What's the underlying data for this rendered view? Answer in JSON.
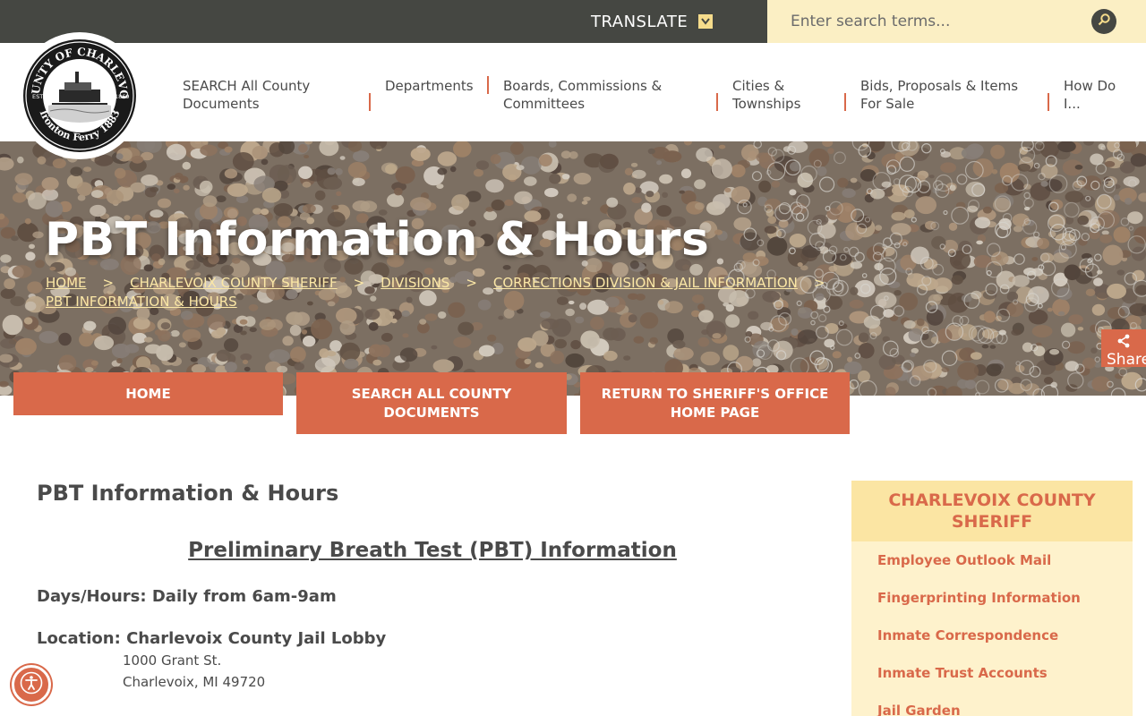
{
  "topbar": {
    "translate_label": "TRANSLATE",
    "search_placeholder": "Enter search terms..."
  },
  "logo": {
    "text_top": "COUNTY OF CHARLEVOIX",
    "text_bottom": "Ironton Ferry 1883",
    "est_left": "EST.",
    "est_right": "1869"
  },
  "nav": {
    "items": [
      {
        "label": "SEARCH All County Documents"
      },
      {
        "label": "Departments"
      },
      {
        "label": "Boards, Commissions & Committees"
      },
      {
        "label": "Cities & Townships"
      },
      {
        "label": "Bids, Proposals & Items For Sale"
      },
      {
        "label": "How Do I..."
      }
    ]
  },
  "hero": {
    "title": "PBT Information & Hours",
    "breadcrumbs": [
      "HOME",
      "CHARLEVOIX COUNTY SHERIFF",
      "DIVISIONS",
      "CORRECTIONS DIVISION & JAIL INFORMATION",
      "PBT INFORMATION & HOURS"
    ],
    "separator": ">",
    "share_label": "Share"
  },
  "quick_buttons": [
    "HOME",
    "SEARCH ALL COUNTY DOCUMENTS",
    "RETURN TO SHERIFF'S OFFICE HOME PAGE"
  ],
  "main": {
    "page_heading": "PBT Information & Hours",
    "section_title": "Preliminary Breath Test (PBT) Information",
    "hours_line": "Days/Hours:  Daily from 6am-9am",
    "location_line": "Location:  Charlevoix County Jail Lobby",
    "address_line1": "1000 Grant St.",
    "address_line2": "Charlevoix, MI 49720"
  },
  "sidebar": {
    "heading": "CHARLEVOIX COUNTY SHERIFF",
    "links": [
      "Employee Outlook Mail",
      "Fingerprinting Information",
      "Inmate Correspondence",
      "Inmate Trust Accounts",
      "Jail Garden"
    ]
  },
  "colors": {
    "accent": "#d9694a",
    "topbar": "#454742",
    "search_bg": "#fbefc4",
    "sidebar_bg": "#fef2cc",
    "sidebar_head": "#fbe5a3",
    "breadcrumb": "#fbe7a6"
  },
  "icons": [
    "chevron-down-icon",
    "search-icon",
    "share-icon",
    "accessibility-icon"
  ]
}
